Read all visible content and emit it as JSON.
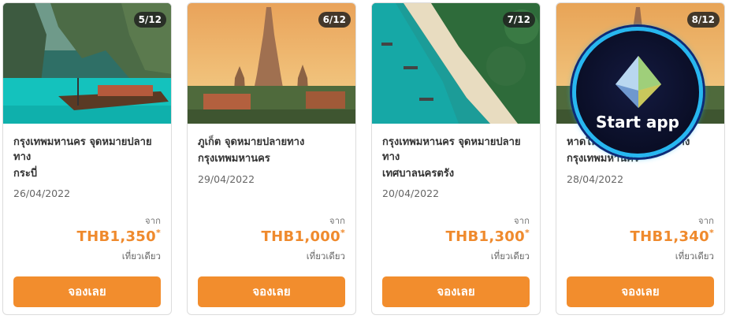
{
  "cards": [
    {
      "counter": "5/12",
      "title": "กรุงเทพมหานคร จุดหมายปลายทาง",
      "destination": "กระบี่",
      "date": "26/04/2022",
      "from_label": "จาก",
      "price": "THB1,350",
      "asterisk": "*",
      "trip_type": "เที่ยวเดียว",
      "book_label": "จองเลย"
    },
    {
      "counter": "6/12",
      "title": "ภูเก็ต จุดหมายปลายทาง",
      "destination": "กรุงเทพมหานคร",
      "date": "29/04/2022",
      "from_label": "จาก",
      "price": "THB1,000",
      "asterisk": "*",
      "trip_type": "เที่ยวเดียว",
      "book_label": "จองเลย"
    },
    {
      "counter": "7/12",
      "title": "กรุงเทพมหานคร จุดหมายปลายทาง",
      "destination": "เทศบาลนครตรัง",
      "date": "20/04/2022",
      "from_label": "จาก",
      "price": "THB1,300",
      "asterisk": "*",
      "trip_type": "เที่ยวเดียว",
      "book_label": "จองเลย"
    },
    {
      "counter": "8/12",
      "title": "หาดใหญ่ จุดหมายปลายทาง",
      "destination": "กรุงเทพมหานคร",
      "date": "28/04/2022",
      "from_label": "จาก",
      "price": "THB1,340",
      "asterisk": "*",
      "trip_type": "เที่ยวเดียว",
      "book_label": "จองเลย"
    }
  ],
  "overlay": {
    "label": "Start app",
    "icon": "gem-icon"
  },
  "colors": {
    "accent": "#ef8a2d",
    "button": "#f28d2d",
    "overlay_ring": "#27b7f0"
  }
}
